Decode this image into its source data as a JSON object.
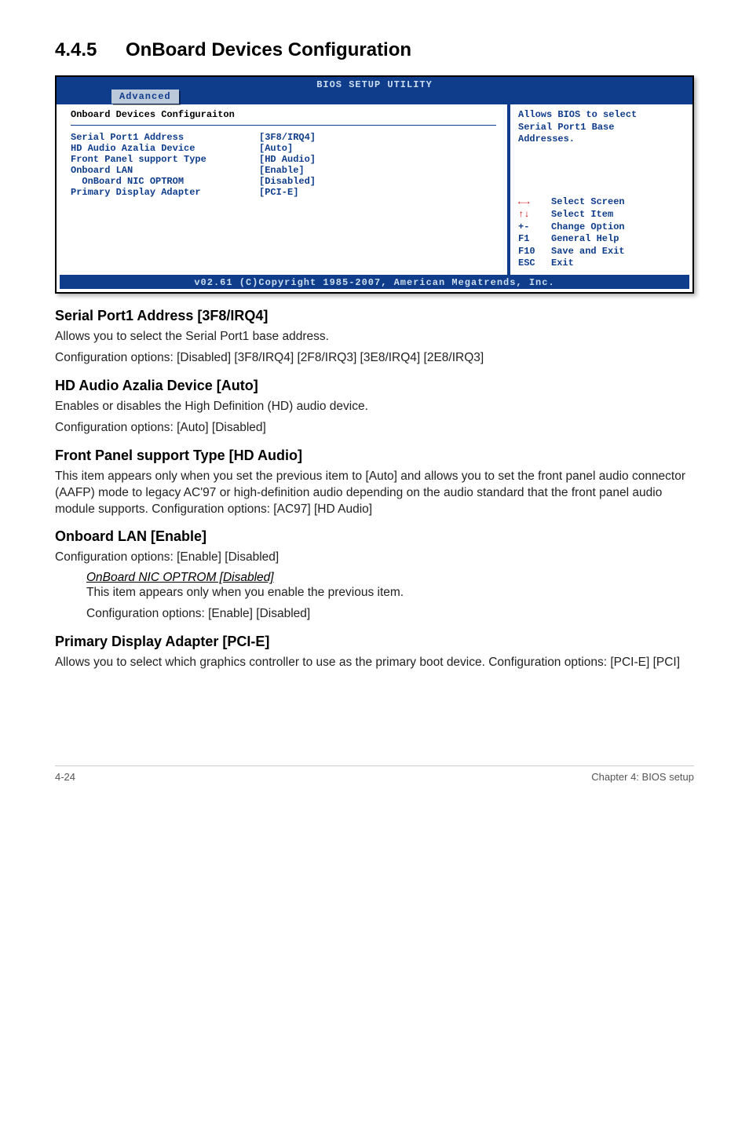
{
  "heading": {
    "number": "4.4.5",
    "title": "OnBoard Devices Configuration"
  },
  "bios": {
    "title": "BIOS SETUP UTILITY",
    "tab": "Advanced",
    "panel_title": "Onboard Devices Configuraiton",
    "rows": [
      {
        "label": "Serial Port1 Address",
        "value": "[3F8/IRQ4]"
      },
      {
        "label": "HD Audio Azalia Device",
        "value": "[Auto]"
      },
      {
        "label": "Front Panel support Type",
        "value": "[HD Audio]"
      },
      {
        "label": "Onboard LAN",
        "value": "[Enable]"
      },
      {
        "label": "  OnBoard NIC OPTROM",
        "value": "[Disabled]"
      },
      {
        "label": "Primary Display Adapter",
        "value": "[PCI-E]"
      }
    ],
    "help": {
      "line1": "Allows BIOS to select",
      "line2": "Serial Port1 Base",
      "line3": "Addresses."
    },
    "keys": [
      {
        "k": "←→",
        "d": "Select Screen",
        "arrow": true
      },
      {
        "k": "↑↓",
        "d": "Select Item",
        "arrow": true
      },
      {
        "k": "+-",
        "d": "Change Option"
      },
      {
        "k": "F1",
        "d": "General Help"
      },
      {
        "k": "F10",
        "d": "Save and Exit"
      },
      {
        "k": "ESC",
        "d": "Exit"
      }
    ],
    "footer": "v02.61 (C)Copyright 1985-2007, American Megatrends, Inc."
  },
  "sections": [
    {
      "title": "Serial Port1 Address [3F8/IRQ4]",
      "paras": [
        "Allows you to select the Serial Port1 base address.",
        "Configuration options: [Disabled] [3F8/IRQ4] [2F8/IRQ3] [3E8/IRQ4] [2E8/IRQ3]"
      ]
    },
    {
      "title": "HD Audio Azalia Device [Auto]",
      "paras": [
        "Enables or disables the High Definition (HD) audio device.",
        "Configuration options: [Auto] [Disabled]"
      ]
    },
    {
      "title": "Front Panel support Type [HD Audio]",
      "paras": [
        "This item appears only when you set the previous item to [Auto] and allows you to set the front panel audio connector (AAFP) mode to legacy AC'97 or high-definition audio depending on the audio standard that the front panel audio module supports. Configuration options: [AC97] [HD Audio]"
      ]
    },
    {
      "title": "Onboard LAN [Enable]",
      "paras": [
        "Configuration options: [Enable] [Disabled]"
      ],
      "sub": {
        "title": "OnBoard NIC OPTROM [Disabled]",
        "paras": [
          "This item appears only when you enable the previous item.",
          "Configuration options: [Enable] [Disabled]"
        ]
      }
    },
    {
      "title": "Primary Display Adapter [PCI-E]",
      "paras": [
        "Allows you to select which graphics controller to use as the primary boot device. Configuration options: [PCI-E] [PCI]"
      ]
    }
  ],
  "footer": {
    "page": "4-24",
    "chapter": "Chapter 4: BIOS setup"
  }
}
